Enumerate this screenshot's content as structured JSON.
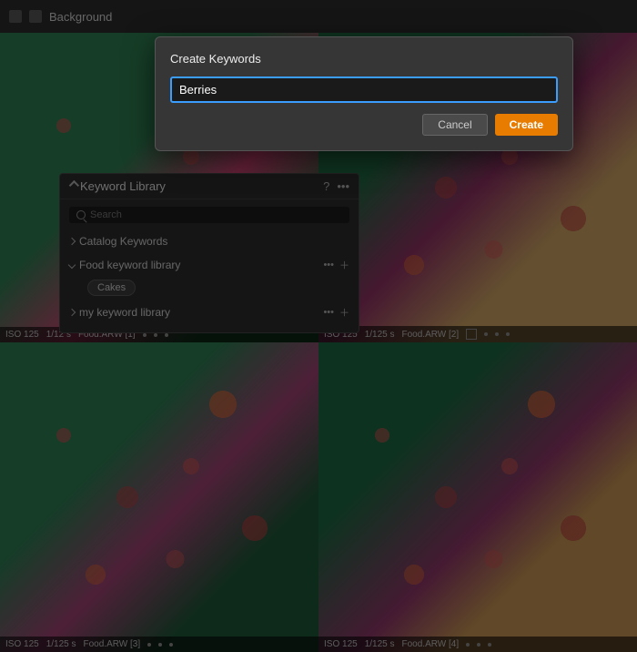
{
  "topbar": {
    "title": "Background",
    "icon_shape": "rect"
  },
  "dialog": {
    "title": "Create Keywords",
    "input_value": "Berries",
    "input_placeholder": "",
    "cancel_label": "Cancel",
    "create_label": "Create"
  },
  "keyword_panel": {
    "title": "Keyword Library",
    "help_label": "?",
    "more_label": "•••",
    "search_placeholder": "Search",
    "catalog_keywords_label": "Catalog Keywords",
    "food_library_label": "Food keyword library",
    "food_library_tag": "Cakes",
    "my_library_label": "my keyword library"
  },
  "photos": [
    {
      "iso": "ISO 125",
      "shutter": "1/12 s",
      "file": "Food.ARW [1]"
    },
    {
      "iso": "ISO 125",
      "shutter": "1/125 s",
      "file": "Food.ARW [2]"
    },
    {
      "iso": "ISO 125",
      "shutter": "1/125 s",
      "file": "Food.ARW [3]"
    },
    {
      "iso": "ISO 125",
      "shutter": "1/125 s",
      "file": "Food.ARW [4]"
    }
  ]
}
